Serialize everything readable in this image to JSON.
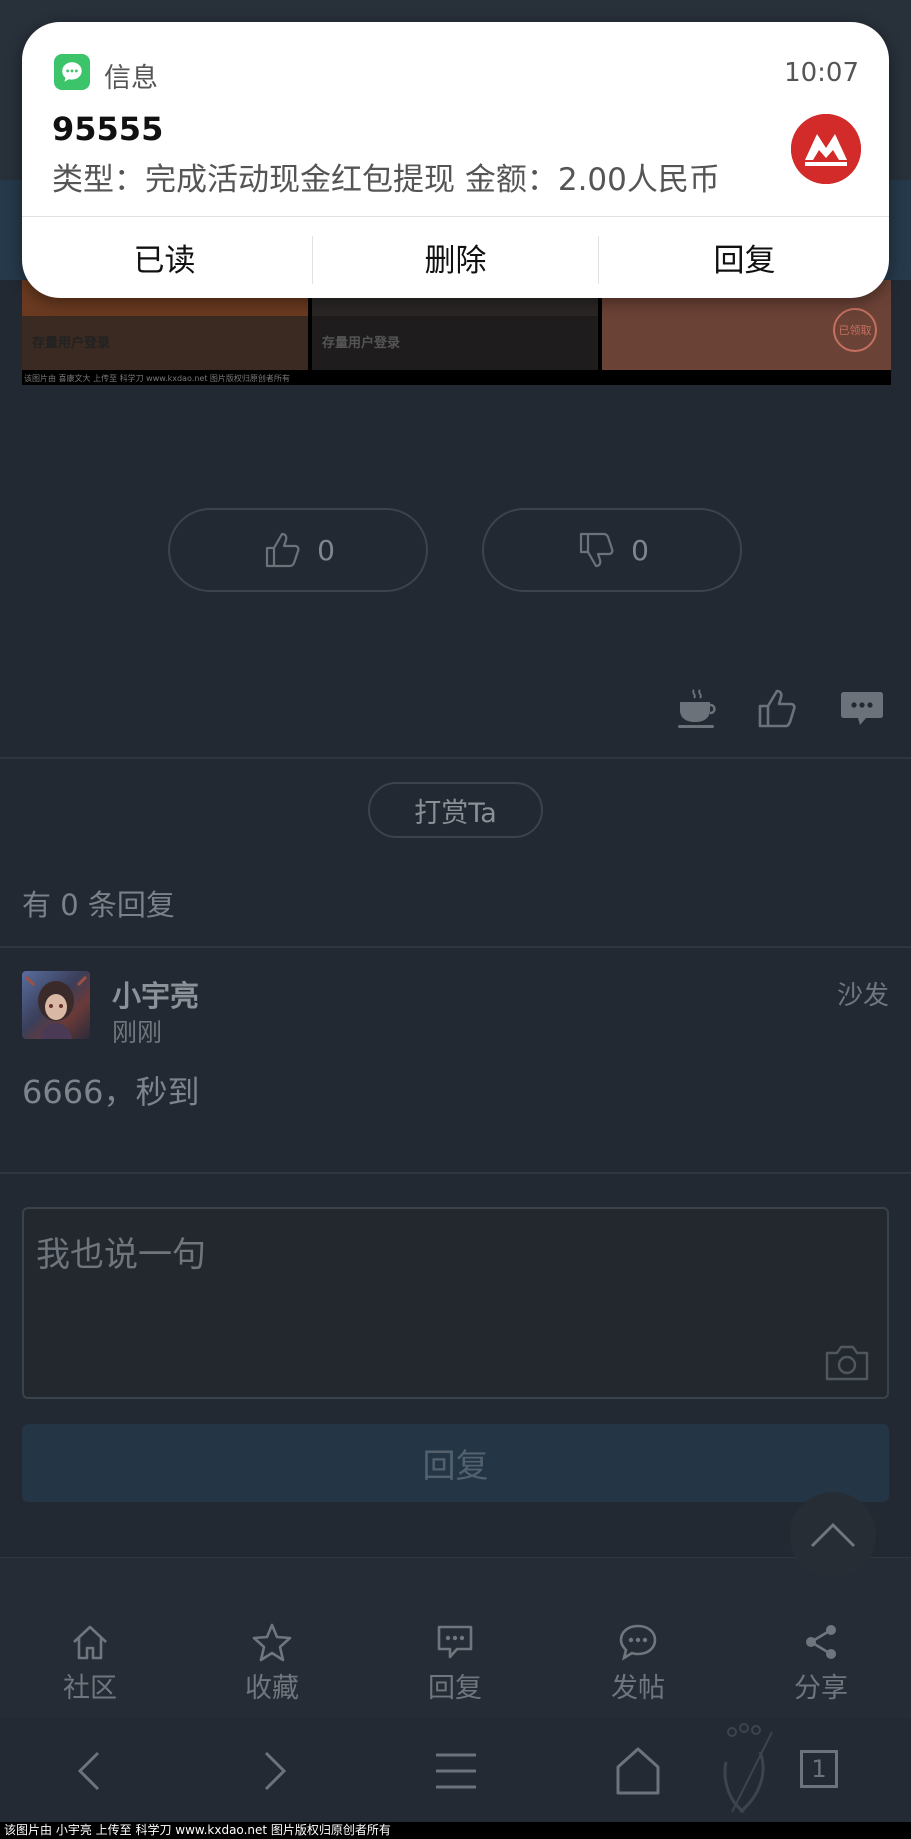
{
  "notification": {
    "app_name": "信息",
    "time": "10:07",
    "sender": "95555",
    "body": "类型：完成活动现金红包提现 金额：2.00人民币",
    "actions": [
      "已读",
      "删除",
      "回复"
    ]
  },
  "post_image": {
    "tile_captions": [
      "存量用户登录",
      "存量用户登录"
    ],
    "tile3_badge": "已领取",
    "watermark": "该图片由 喜康文大 上传至 科学刀 www.kxdao.net 图片版权归原创者所有"
  },
  "votes": {
    "up_count": "0",
    "down_count": "0"
  },
  "reward_button": "打赏Ta",
  "reply_count_text": "有 0 条回复",
  "reply": {
    "username": "小宇亮",
    "time": "刚刚",
    "floor": "沙发",
    "content": "6666，秒到"
  },
  "composer": {
    "placeholder": "我也说一句",
    "submit_label": "回复"
  },
  "bottom_nav": [
    "社区",
    "收藏",
    "回复",
    "发帖",
    "分享"
  ],
  "browser_tab_count": "1",
  "footer_watermark": "该图片由 小宇亮 上传至 科学刀 www.kxdao.net 图片版权归原创者所有"
}
